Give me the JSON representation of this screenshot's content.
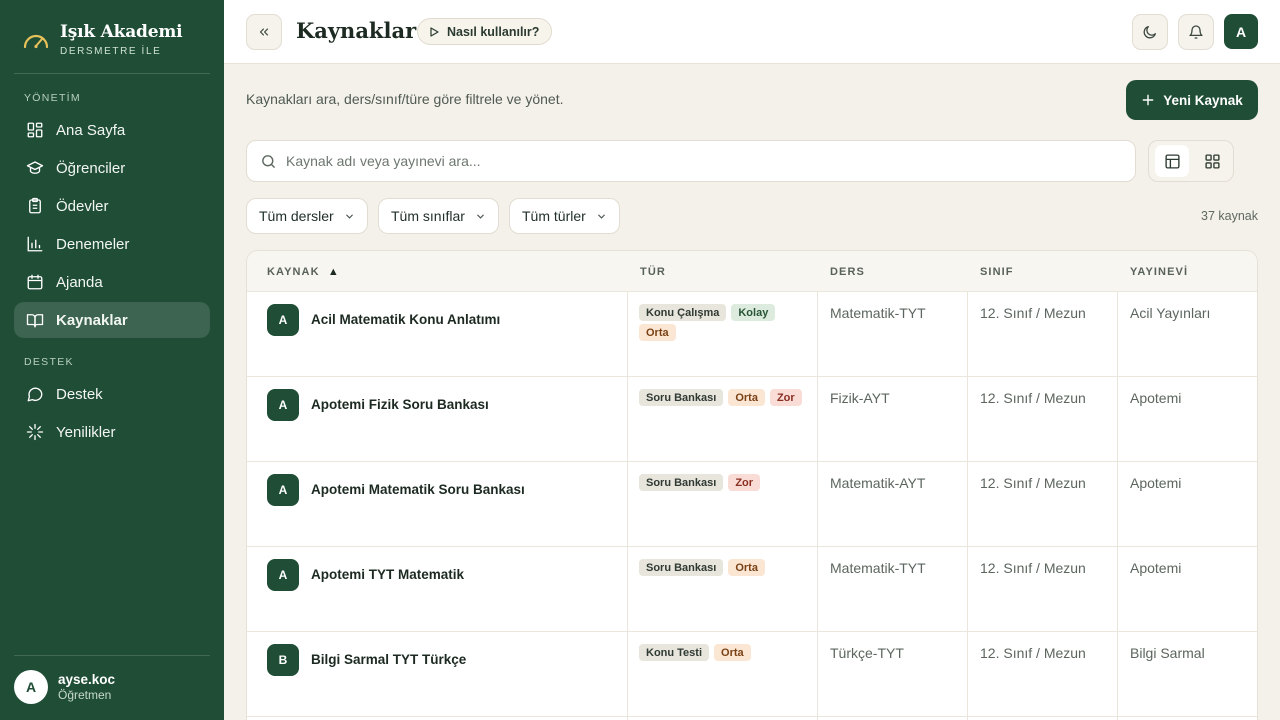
{
  "sidebar": {
    "brand_title": "Işık Akademi",
    "brand_sub": "DERSMETRE İLE",
    "section_manage": "YÖNETİM",
    "section_support": "DESTEK",
    "items": [
      {
        "label": "Ana Sayfa",
        "icon": "grid-icon"
      },
      {
        "label": "Öğrenciler",
        "icon": "graduation-cap-icon"
      },
      {
        "label": "Ödevler",
        "icon": "clipboard-icon"
      },
      {
        "label": "Denemeler",
        "icon": "bar-chart-icon"
      },
      {
        "label": "Ajanda",
        "icon": "calendar-icon"
      },
      {
        "label": "Kaynaklar",
        "icon": "book-open-icon",
        "active": true
      }
    ],
    "support_items": [
      {
        "label": "Destek",
        "icon": "message-circle-icon"
      },
      {
        "label": "Yenilikler",
        "icon": "sparkle-icon"
      }
    ],
    "user": {
      "initial": "A",
      "name": "ayse.koc",
      "role": "Öğretmen"
    }
  },
  "header": {
    "title": "Kaynaklar",
    "howto_label": "Nasıl kullanılır?",
    "avatar_initial": "A"
  },
  "main": {
    "subtitle": "Kaynakları ara, ders/sınıf/türe göre filtrele ve yönet.",
    "new_button": "Yeni Kaynak",
    "search_placeholder": "Kaynak adı veya yayınevi ara...",
    "search_value": "",
    "filters": [
      "Tüm dersler",
      "Tüm sınıflar",
      "Tüm türler"
    ],
    "count": "37 kaynak"
  },
  "table": {
    "columns": {
      "kaynak": "KAYNAK",
      "sort_indicator": "▲",
      "tur": "TÜR",
      "ders": "DERS",
      "sinif": "SINIF",
      "yayinevi": "YAYINEVİ"
    },
    "rows": [
      {
        "initial": "A",
        "name": "Acil Matematik Konu Anlatımı",
        "badges": [
          {
            "text": "Konu Çalışma",
            "kind": "type"
          },
          {
            "text": "Kolay",
            "kind": "easy"
          },
          {
            "text": "Orta",
            "kind": "medium"
          }
        ],
        "ders": "Matematik-TYT",
        "sinif": "12. Sınıf / Mezun",
        "yayinevi": "Acil Yayınları"
      },
      {
        "initial": "A",
        "name": "Apotemi Fizik Soru Bankası",
        "badges": [
          {
            "text": "Soru Bankası",
            "kind": "type"
          },
          {
            "text": "Orta",
            "kind": "medium"
          },
          {
            "text": "Zor",
            "kind": "hard"
          }
        ],
        "ders": "Fizik-AYT",
        "sinif": "12. Sınıf / Mezun",
        "yayinevi": "Apotemi"
      },
      {
        "initial": "A",
        "name": "Apotemi Matematik Soru Bankası",
        "badges": [
          {
            "text": "Soru Bankası",
            "kind": "type"
          },
          {
            "text": "Zor",
            "kind": "hard"
          }
        ],
        "ders": "Matematik-AYT",
        "sinif": "12. Sınıf / Mezun",
        "yayinevi": "Apotemi"
      },
      {
        "initial": "A",
        "name": "Apotemi TYT Matematik",
        "badges": [
          {
            "text": "Soru Bankası",
            "kind": "type"
          },
          {
            "text": "Orta",
            "kind": "medium"
          }
        ],
        "ders": "Matematik-TYT",
        "sinif": "12. Sınıf / Mezun",
        "yayinevi": "Apotemi"
      },
      {
        "initial": "B",
        "name": "Bilgi Sarmal TYT Türkçe",
        "badges": [
          {
            "text": "Konu Testi",
            "kind": "type"
          },
          {
            "text": "Orta",
            "kind": "medium"
          }
        ],
        "ders": "Türkçe-TYT",
        "sinif": "12. Sınıf / Mezun",
        "yayinevi": "Bilgi Sarmal"
      }
    ]
  },
  "colors": {
    "brand": "#1f4d36",
    "page_bg": "#f4f1ea",
    "badge_type_bg": "#e8e5dc",
    "badge_easy_bg": "#dcebdd",
    "badge_medium_bg": "#fbe6d3",
    "badge_hard_bg": "#f9dcd6"
  }
}
